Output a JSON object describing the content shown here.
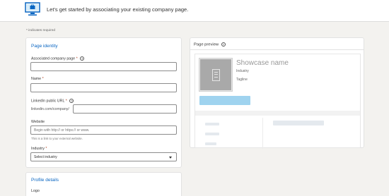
{
  "header": {
    "intro_text": "Let's get started by associating your existing company page.",
    "icon": "monitor-briefcase-icon"
  },
  "required_note": "* indicates required",
  "identity": {
    "title": "Page identity",
    "associated": {
      "label": "Associated company page",
      "required_mark": "*",
      "help": "?"
    },
    "name": {
      "label": "Name",
      "required_mark": "*"
    },
    "url": {
      "label": "LinkedIn public URL",
      "required_mark": "*",
      "help": "?",
      "prefix": "linkedin.com/company/"
    },
    "website": {
      "label": "Website",
      "placeholder": "Begin with http:// or https:// or www.",
      "hint": "This is a link to your external website."
    },
    "industry": {
      "label": "Industry",
      "required_mark": "*",
      "value": "Select industry"
    }
  },
  "profile": {
    "title": "Profile details",
    "logo_label": "Logo"
  },
  "preview": {
    "title": "Page preview",
    "help": "?",
    "showcase_name": "Showcase name",
    "industry": "Industry",
    "tagline": "Tagline"
  },
  "colors": {
    "accent": "#0a66c2",
    "follow_button": "#9fd3ef",
    "logo_placeholder": "#a9a9a9"
  }
}
